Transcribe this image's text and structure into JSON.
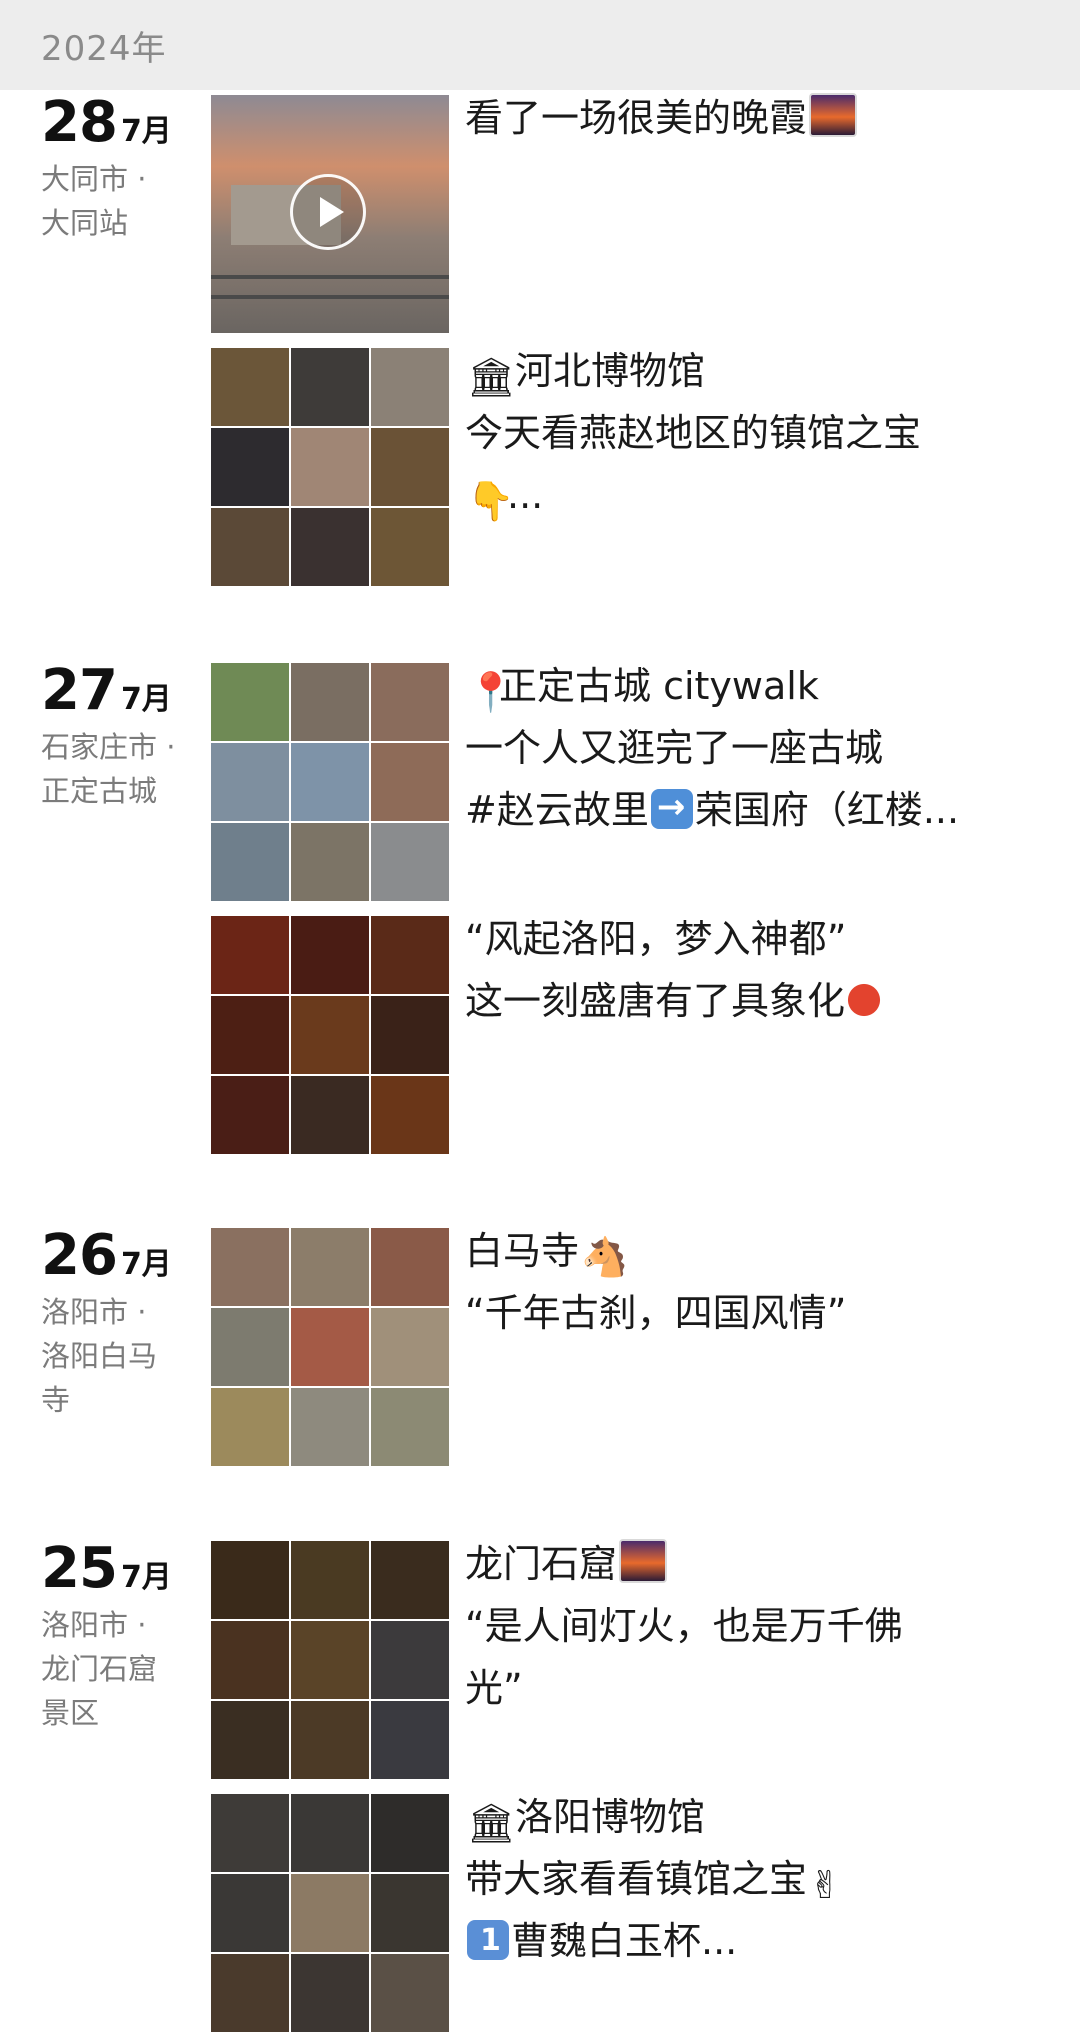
{
  "header": {
    "year": "2024年"
  },
  "days": [
    {
      "day": "28",
      "month": "7月",
      "location": [
        "大同市 ·",
        "大同站"
      ],
      "posts": [
        {
          "type": "video",
          "lines": [
            [
              "看了一场很美的晚霞",
              "sunset"
            ]
          ],
          "thumb_colors": [
            "#cf8f6d",
            "#8d7e74",
            "#6a6561"
          ]
        },
        {
          "type": "grid",
          "lines": [
            [
              "",
              "museum",
              "河北博物馆"
            ],
            [
              "今天看燕赵地区的镇馆之宝"
            ],
            [
              "",
              "pointing-down-hand",
              "..."
            ]
          ],
          "cells": [
            "#6b5639",
            "#3e3b39",
            "#8b8176",
            "#2d2b2f",
            "#a08675",
            "#6a5236",
            "#5b4937",
            "#3a3130",
            "#6d5636"
          ]
        }
      ]
    },
    {
      "day": "27",
      "month": "7月",
      "location": [
        "石家庄市 ·",
        "正定古城"
      ],
      "posts": [
        {
          "type": "grid",
          "lines": [
            [
              "",
              "pin",
              "正定古城 citywalk"
            ],
            [
              "一个人又逛完了一座古城"
            ],
            [
              "#赵云故里",
              "arrow-right",
              "荣国府（红楼..."
            ]
          ],
          "cells": [
            "#6f8a55",
            "#7a6e62",
            "#8a6c5c",
            "#7e8f9f",
            "#7e93a8",
            "#8e6b58",
            "#6f7f8c",
            "#7c7466",
            "#8a8c8e"
          ]
        },
        {
          "type": "grid",
          "lines": [
            [
              "“风起洛阳，梦入神都”"
            ],
            [
              "这一刻盛唐有了具象化",
              "lantern"
            ]
          ],
          "cells": [
            "#6b2516",
            "#4a1c14",
            "#5a2a18",
            "#4d1f14",
            "#6a3a1c",
            "#3a2218",
            "#4a1e16",
            "#3a2a22",
            "#6a3618"
          ]
        }
      ]
    },
    {
      "day": "26",
      "month": "7月",
      "location": [
        "洛阳市 ·",
        "洛阳白马",
        "寺"
      ],
      "posts": [
        {
          "type": "grid",
          "lines": [
            [
              "白马寺",
              "horse"
            ],
            [
              "“千年古刹，四国风情”"
            ]
          ],
          "cells": [
            "#8a7060",
            "#8c7d6a",
            "#8a5a48",
            "#7d7b6f",
            "#a45a46",
            "#a0907a",
            "#9c8a5c",
            "#8e8a7e",
            "#8c8a74"
          ]
        }
      ]
    },
    {
      "day": "25",
      "month": "7月",
      "location": [
        "洛阳市 ·",
        "龙门石窟",
        "景区"
      ],
      "posts": [
        {
          "type": "grid",
          "lines": [
            [
              "龙门石窟",
              "sunset"
            ],
            [
              "“是人间灯火，也是万千佛"
            ],
            [
              "光”"
            ]
          ],
          "cells": [
            "#3a2a1a",
            "#4a3a22",
            "#3a2c1e",
            "#4a3220",
            "#5a4428",
            "#3c3a3c",
            "#3a2e22",
            "#4c3a26",
            "#3a3a40"
          ]
        },
        {
          "type": "grid",
          "lines": [
            [
              "",
              "museum",
              "洛阳博物馆"
            ],
            [
              "带大家看看镇馆之宝",
              "victory-hand"
            ],
            [
              "",
              "keycap-1",
              "曹魏白玉杯..."
            ]
          ],
          "cells": [
            "#3e3b38",
            "#3a3836",
            "#2e2c2a",
            "#3a3836",
            "#8c7a64",
            "#3a3630",
            "#4a3a2c",
            "#3c3632",
            "#5a5046"
          ]
        }
      ]
    }
  ]
}
